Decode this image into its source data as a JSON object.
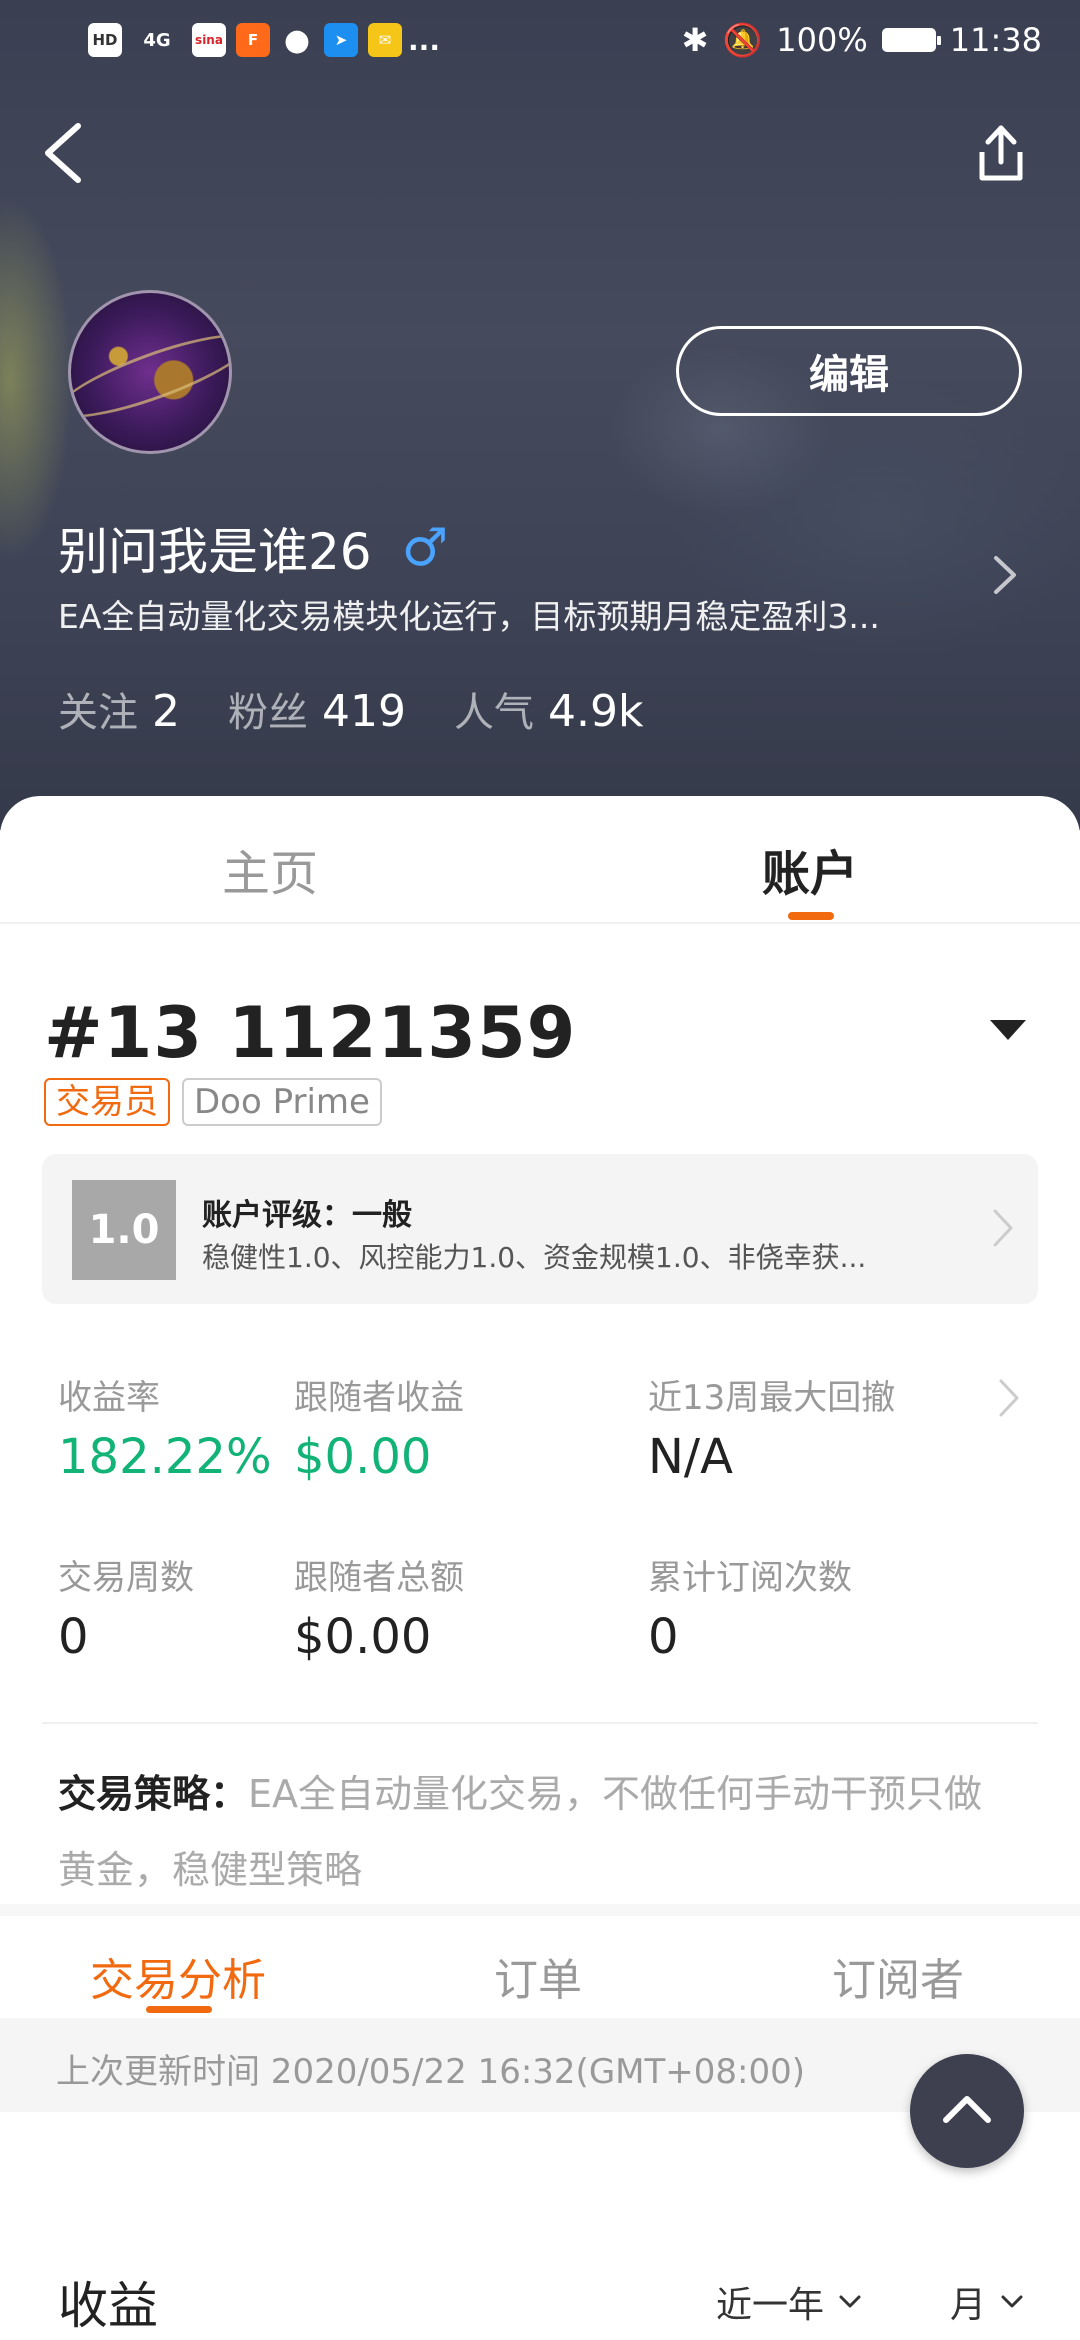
{
  "status_bar": {
    "left_icons": [
      "HD",
      "4G",
      "sina",
      "F",
      "msg",
      "bird",
      "mail",
      "..."
    ],
    "battery": "100%",
    "time": "11:38"
  },
  "header": {
    "edit_label": "编辑",
    "username": "别问我是谁26",
    "gender_symbol": "♂",
    "bio": "EA全自动量化交易模块化运行，目标预期月稳定盈利3...",
    "stats": [
      {
        "label": "关注",
        "value": "2"
      },
      {
        "label": "粉丝",
        "value": "419"
      },
      {
        "label": "人气",
        "value": "4.9k"
      }
    ]
  },
  "main_tabs": [
    {
      "label": "主页",
      "active": false
    },
    {
      "label": "账户",
      "active": true
    }
  ],
  "account": {
    "number": "#13 1121359",
    "tags": [
      "交易员",
      "Doo Prime"
    ],
    "rating": {
      "score": "1.0",
      "title": "账户评级：一般",
      "desc": "稳健性1.0、风控能力1.0、资金规模1.0、非侥幸获..."
    },
    "metrics": [
      {
        "label": "收益率",
        "value": "182.22%"
      },
      {
        "label": "跟随者收益",
        "value": "$0.00"
      },
      {
        "label": "近13周最大回撤",
        "value": "N/A"
      },
      {
        "label": "交易周数",
        "value": "0"
      },
      {
        "label": "跟随者总额",
        "value": "$0.00"
      },
      {
        "label": "累计订阅次数",
        "value": "0"
      }
    ],
    "strategy_label": "交易策略：",
    "strategy_text": "EA全自动量化交易，不做任何手动干预只做黄金，稳健型策略"
  },
  "sub_tabs": [
    {
      "label": "交易分析",
      "active": true
    },
    {
      "label": "订单",
      "active": false
    },
    {
      "label": "订阅者",
      "active": false
    }
  ],
  "update_text": "上次更新时间 2020/05/22 16:32(GMT+08:00)",
  "section": {
    "title": "收益",
    "period_filter": "近一年",
    "unit_filter": "月"
  },
  "colors": {
    "accent": "#f26a10",
    "positive": "#12b377",
    "header_bg": "#40455a"
  }
}
